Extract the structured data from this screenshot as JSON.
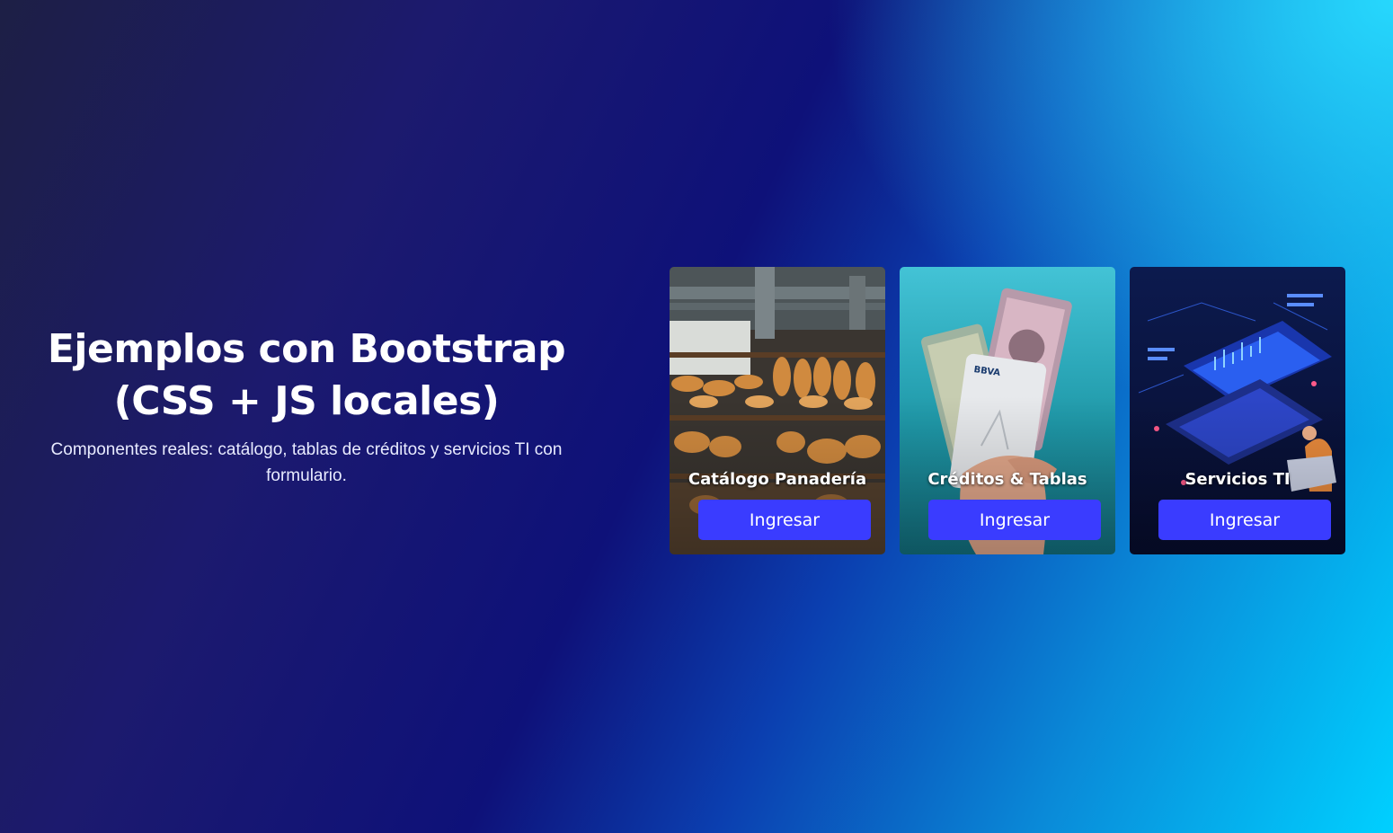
{
  "hero": {
    "title_line1": "Ejemplos con Bootstrap",
    "title_line2": "(CSS + JS locales)",
    "subtitle": "Componentes reales: catálogo, tablas de créditos y servicios TI con formulario."
  },
  "cards": [
    {
      "title": "Catálogo Panadería",
      "button_label": "Ingresar",
      "image": "bakery-bread-shelves"
    },
    {
      "title": "Créditos & Tablas",
      "button_label": "Ingresar",
      "image": "bbva-card-and-banknotes-in-hand"
    },
    {
      "title": "Servicios TI",
      "button_label": "Ingresar",
      "image": "isometric-it-laptop-data-illustration"
    }
  ],
  "colors": {
    "button": "#3a3cff",
    "background_dark": "#0e1179",
    "background_light": "#00d0ff"
  }
}
